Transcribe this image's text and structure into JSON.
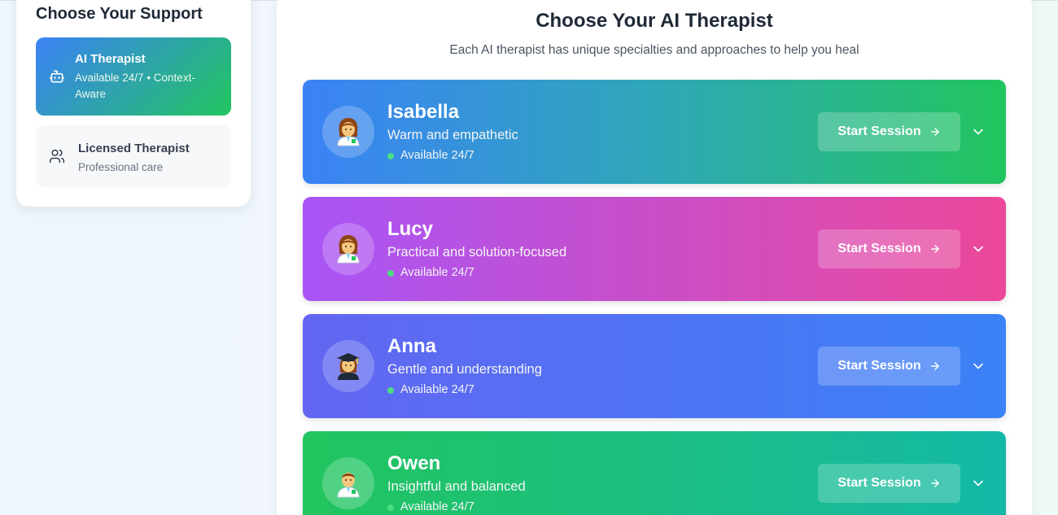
{
  "sidebar": {
    "title": "Choose Your Support",
    "options": [
      {
        "title": "AI Therapist",
        "subtitle": "Available 24/7 • Context-Aware",
        "icon": "bot-icon",
        "selected": true
      },
      {
        "title": "Licensed Therapist",
        "subtitle": "Professional care",
        "icon": "users-icon",
        "selected": false
      }
    ]
  },
  "main": {
    "title": "Choose Your AI Therapist",
    "subtitle": "Each AI therapist has unique specialties and approaches to help you heal",
    "therapists": [
      {
        "name": "Isabella",
        "description": "Warm and empathetic",
        "status": "Available 24/7",
        "button": "Start Session",
        "avatar": "woman-health-worker-emoji",
        "colors": [
          "#3b82f6",
          "#22c55e"
        ]
      },
      {
        "name": "Lucy",
        "description": "Practical and solution-focused",
        "status": "Available 24/7",
        "button": "Start Session",
        "avatar": "woman-health-worker-emoji",
        "colors": [
          "#a855f7",
          "#ec4899"
        ]
      },
      {
        "name": "Anna",
        "description": "Gentle and understanding",
        "status": "Available 24/7",
        "button": "Start Session",
        "avatar": "woman-graduate-emoji",
        "colors": [
          "#6366f1",
          "#3b82f6"
        ]
      },
      {
        "name": "Owen",
        "description": "Insightful and balanced",
        "status": "Available 24/7",
        "button": "Start Session",
        "avatar": "man-health-worker-emoji",
        "colors": [
          "#22c55e",
          "#14b8a6"
        ]
      }
    ]
  }
}
